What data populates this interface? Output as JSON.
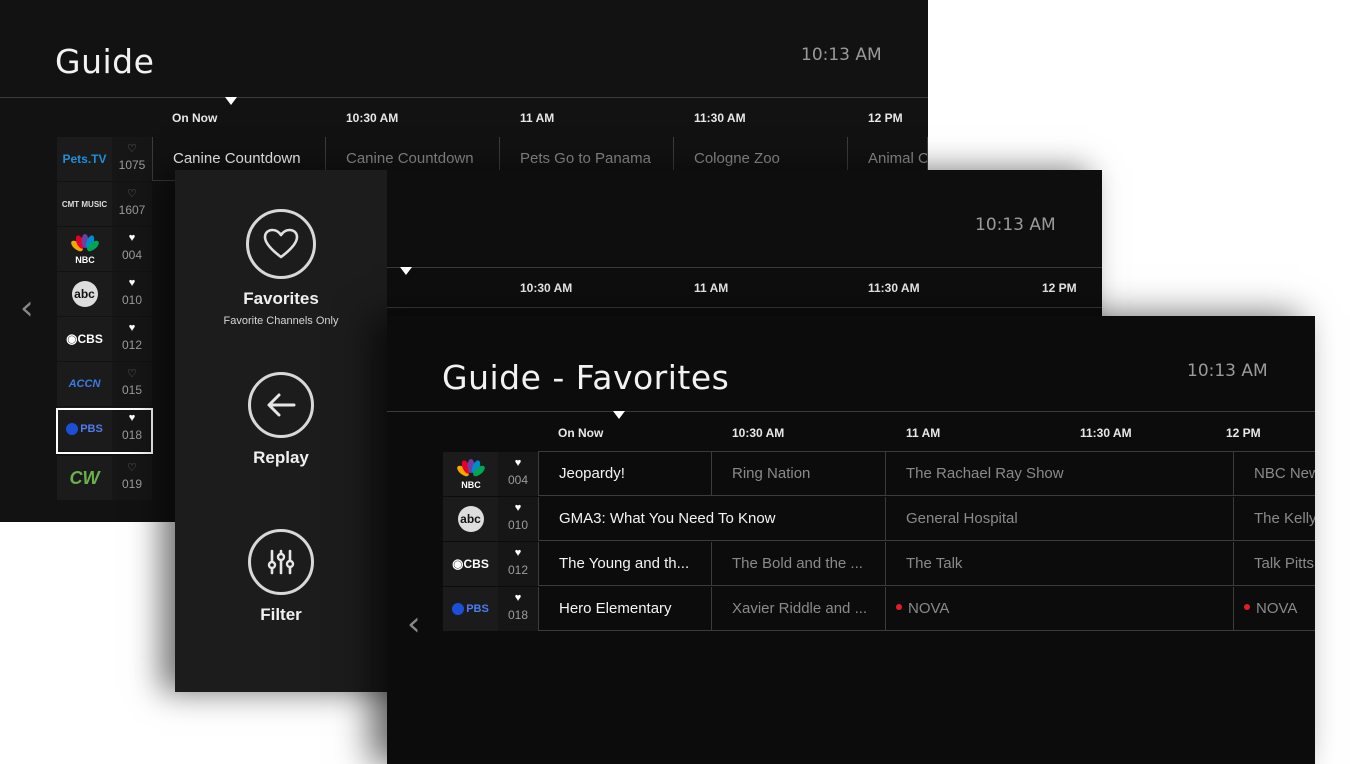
{
  "screen1": {
    "title": "Guide",
    "clock": "10:13 AM",
    "times": [
      "On Now",
      "10:30 AM",
      "11 AM",
      "11:30 AM",
      "12 PM"
    ],
    "first_row_programs": [
      "Canine Countdown",
      "Canine Countdown",
      "Pets Go to Panama",
      "Cologne Zoo",
      "Animal C"
    ],
    "channels": [
      {
        "logo": "Pets.TV",
        "number": "1075",
        "favorite": false
      },
      {
        "logo": "CMT MUSIC",
        "number": "1607",
        "favorite": false
      },
      {
        "logo": "NBC",
        "number": "004",
        "favorite": true
      },
      {
        "logo": "abc",
        "number": "010",
        "favorite": true
      },
      {
        "logo": "CBS",
        "number": "012",
        "favorite": true
      },
      {
        "logo": "ACCN",
        "number": "015",
        "favorite": false
      },
      {
        "logo": "PBS",
        "number": "018",
        "favorite": true
      },
      {
        "logo": "CW",
        "number": "019",
        "favorite": false
      }
    ],
    "prev_arrow": "‹"
  },
  "screen2": {
    "clock": "10:13 AM",
    "times": [
      "10:30 AM",
      "11 AM",
      "11:30 AM",
      "12 PM"
    ],
    "menu": {
      "favorites_label": "Favorites",
      "favorites_sub": "Favorite Channels Only",
      "replay_label": "Replay",
      "filter_label": "Filter"
    }
  },
  "screen3": {
    "title": "Guide - Favorites",
    "clock": "10:13 AM",
    "times": [
      "On Now",
      "10:30 AM",
      "11 AM",
      "11:30 AM",
      "12 PM"
    ],
    "prev_arrow": "‹",
    "rows": [
      {
        "logo": "NBC",
        "number": "004",
        "now": "Jeopardy!",
        "p2": "Ring Nation",
        "p3": "The Rachael Ray Show",
        "p4": "NBC New"
      },
      {
        "logo": "abc",
        "number": "010",
        "now": "GMA3: What You Need To Know",
        "p3": "General Hospital",
        "p4": "The Kelly"
      },
      {
        "logo": "CBS",
        "number": "012",
        "now": "The Young and th...",
        "p2": "The Bold and the ...",
        "p3": "The Talk",
        "p4": "Talk Pitts"
      },
      {
        "logo": "PBS",
        "number": "018",
        "now": "Hero Elementary",
        "p2": "Xavier Riddle and ...",
        "p3": "NOVA",
        "p4": "NOVA"
      }
    ]
  },
  "colors": {
    "accent_red": "#e51c23",
    "nbc_peacock": [
      "#f7a800",
      "#e4002b",
      "#6e3fa3",
      "#0089d0",
      "#00a651",
      "#f47920"
    ],
    "pbs_blue": "#1c4fd8",
    "cw_green": "#6ab04c"
  }
}
